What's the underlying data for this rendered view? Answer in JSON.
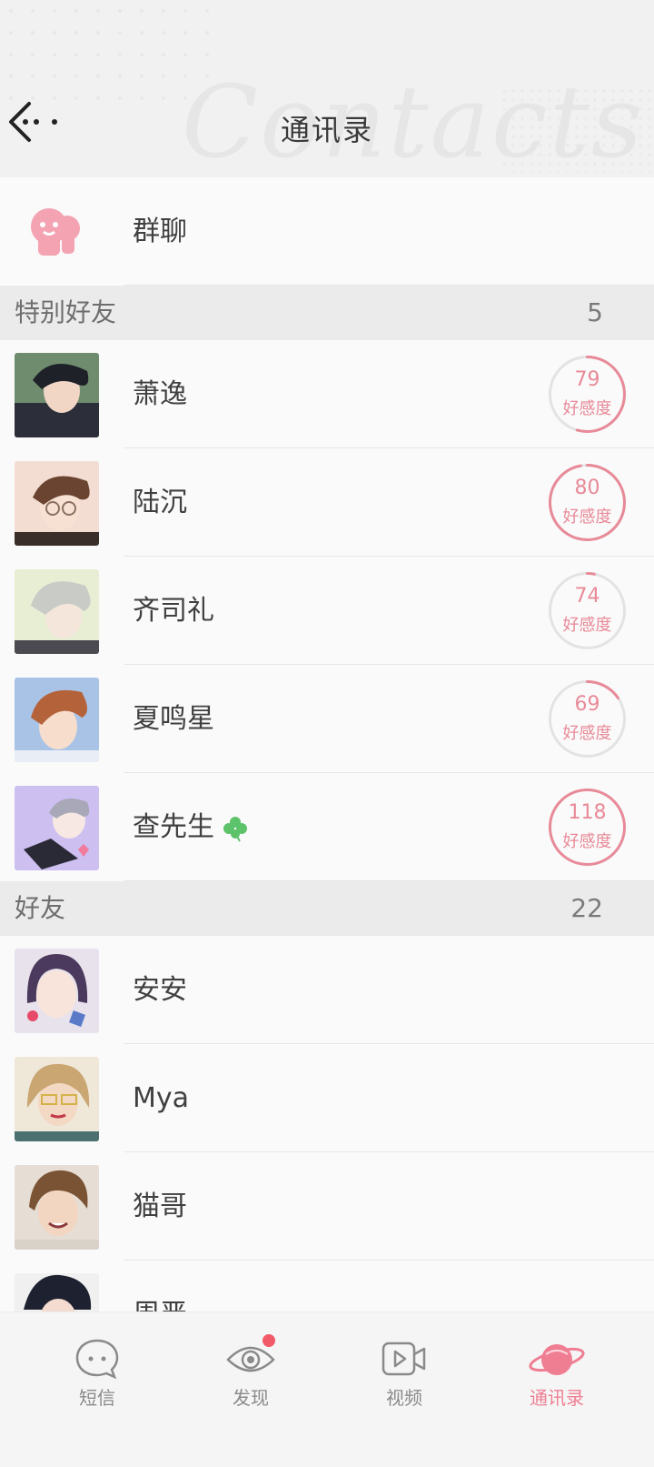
{
  "header": {
    "title": "通讯录",
    "decoration_text": "Contacts"
  },
  "group_chat": {
    "label": "群聊",
    "icon": "group-chat-icon"
  },
  "special_friends": {
    "title": "特别好友",
    "count": "5",
    "items": [
      {
        "name": "萧逸",
        "affinity": "79",
        "affinity_label": "好感度",
        "avatar": "avatar-xiaoyi"
      },
      {
        "name": "陆沉",
        "affinity": "80",
        "affinity_label": "好感度",
        "avatar": "avatar-luchen"
      },
      {
        "name": "齐司礼",
        "affinity": "74",
        "affinity_label": "好感度",
        "avatar": "avatar-qisili"
      },
      {
        "name": "夏鸣星",
        "affinity": "69",
        "affinity_label": "好感度",
        "avatar": "avatar-xiamingxing"
      },
      {
        "name": "查先生",
        "affinity": "118",
        "affinity_label": "好感度",
        "avatar": "avatar-zha",
        "clover": true
      }
    ]
  },
  "friends": {
    "title": "好友",
    "count": "22",
    "items": [
      {
        "name": "安安",
        "avatar": "avatar-anan"
      },
      {
        "name": "Mya",
        "avatar": "avatar-mya"
      },
      {
        "name": "猫哥",
        "avatar": "avatar-maoge"
      },
      {
        "name": "周严",
        "avatar": "avatar-partial"
      }
    ]
  },
  "bottom_nav": [
    {
      "label": "短信",
      "icon": "sms-icon"
    },
    {
      "label": "发现",
      "icon": "eye-icon",
      "badge": true
    },
    {
      "label": "视频",
      "icon": "video-icon"
    },
    {
      "label": "通讯录",
      "icon": "contacts-planet-icon",
      "active": true
    }
  ],
  "colors": {
    "accent": "#f07e93",
    "affinity_ring": "#e88a98",
    "section_bg": "#ebebeb"
  }
}
